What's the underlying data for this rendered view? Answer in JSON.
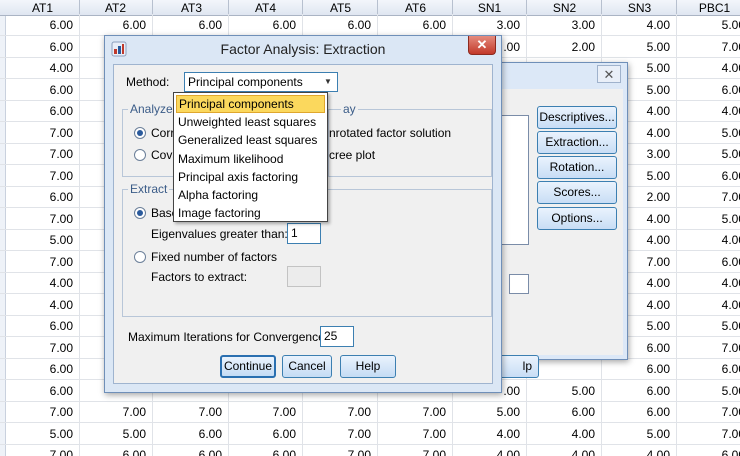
{
  "sheet": {
    "headers": [
      "AT1",
      "AT2",
      "AT3",
      "AT4",
      "AT5",
      "AT6",
      "SN1",
      "SN2",
      "SN3",
      "PBC1"
    ],
    "rows": [
      [
        "6.00",
        "6.00",
        "6.00",
        "6.00",
        "6.00",
        "6.00",
        "3.00",
        "3.00",
        "4.00",
        "5.00"
      ],
      [
        "6.00",
        "",
        "",
        "",
        "",
        "",
        ".00",
        "2.00",
        "5.00",
        "7.00"
      ],
      [
        "4.00",
        "",
        "",
        "",
        "",
        "",
        "",
        "",
        "5.00",
        "4.00"
      ],
      [
        "6.00",
        "",
        "",
        "",
        "",
        "",
        "",
        "",
        "5.00",
        "6.00"
      ],
      [
        "6.00",
        "",
        "",
        "",
        "",
        "",
        "",
        "",
        "4.00",
        "4.00"
      ],
      [
        "7.00",
        "",
        "",
        "",
        "",
        "",
        "",
        "",
        "4.00",
        "5.00"
      ],
      [
        "7.00",
        "",
        "",
        "",
        "",
        "",
        "",
        "",
        "3.00",
        "5.00"
      ],
      [
        "7.00",
        "",
        "",
        "",
        "",
        "",
        "",
        "",
        "5.00",
        "6.00"
      ],
      [
        "6.00",
        "",
        "",
        "",
        "",
        "",
        "",
        "",
        "2.00",
        "7.00"
      ],
      [
        "7.00",
        "",
        "",
        "",
        "",
        "",
        "",
        "",
        "4.00",
        "5.00"
      ],
      [
        "5.00",
        "",
        "",
        "",
        "",
        "",
        "",
        "",
        "4.00",
        "4.00"
      ],
      [
        "7.00",
        "",
        "",
        "",
        "",
        "",
        "",
        "",
        "7.00",
        "6.00"
      ],
      [
        "4.00",
        "",
        "",
        "",
        "",
        "",
        "",
        "",
        "4.00",
        "4.00"
      ],
      [
        "4.00",
        "",
        "",
        "",
        "",
        "",
        "",
        "",
        "4.00",
        "4.00"
      ],
      [
        "6.00",
        "",
        "",
        "",
        "",
        "",
        "",
        "",
        "5.00",
        "5.00"
      ],
      [
        "7.00",
        "",
        "",
        "",
        "",
        "",
        "",
        "",
        "6.00",
        "7.00"
      ],
      [
        "6.00",
        "",
        "",
        "",
        "",
        "",
        "",
        "",
        "6.00",
        "6.00"
      ],
      [
        "6.00",
        "",
        "",
        "",
        "",
        "",
        ".00",
        "5.00",
        "6.00",
        "5.00"
      ],
      [
        "7.00",
        "7.00",
        "7.00",
        "7.00",
        "7.00",
        "7.00",
        "5.00",
        "6.00",
        "6.00",
        "7.00"
      ],
      [
        "5.00",
        "5.00",
        "6.00",
        "6.00",
        "7.00",
        "7.00",
        "4.00",
        "4.00",
        "5.00",
        "7.00"
      ],
      [
        "7.00",
        "6.00",
        "6.00",
        "6.00",
        "7.00",
        "7.00",
        "4.00",
        "4.00",
        "4.00",
        "6.00"
      ]
    ]
  },
  "back_dialog": {
    "side_buttons": [
      "Descriptives...",
      "Extraction...",
      "Rotation...",
      "Scores...",
      "Options..."
    ],
    "help_fragment": "lp",
    "close_glyph": "✕"
  },
  "dialog": {
    "title": "Factor Analysis: Extraction",
    "close_glyph": "✕",
    "method_label": "Method:",
    "method_value": "Principal components",
    "analyze": {
      "title": "Analyze",
      "opt1": "Corre",
      "opt2": "Cova",
      "selected": 0
    },
    "display": {
      "title": "ay",
      "opt1": "nrotated factor solution",
      "opt2": "cree plot"
    },
    "extract": {
      "title": "Extract",
      "opt1": "Base",
      "eigen_label": "Eigenvalues greater than:",
      "eigen_value": "1",
      "opt2": "Fixed number of factors",
      "factors_label": "Factors to extract:",
      "factors_value": "",
      "selected": 0
    },
    "max_iter_label": "Maximum Iterations for Convergence:",
    "max_iter_value": "25",
    "buttons": {
      "continue": "Continue",
      "cancel": "Cancel",
      "help": "Help"
    }
  },
  "method_options": [
    "Principal components",
    "Unweighted least squares",
    "Generalized least squares",
    "Maximum likelihood",
    "Principal axis factoring",
    "Alpha factoring",
    "Image factoring"
  ],
  "method_selected_index": 0
}
